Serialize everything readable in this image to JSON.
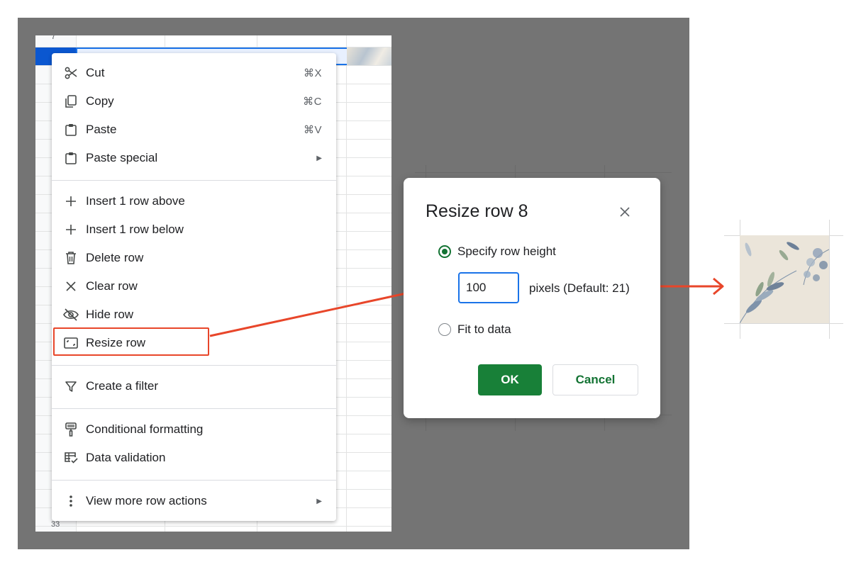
{
  "sheet": {
    "top_row_number": "7",
    "bottom_row_number": "33"
  },
  "context_menu": {
    "items": [
      {
        "label": "Cut",
        "shortcut": "⌘X",
        "icon": "scissors-icon"
      },
      {
        "label": "Copy",
        "shortcut": "⌘C",
        "icon": "copy-icon"
      },
      {
        "label": "Paste",
        "shortcut": "⌘V",
        "icon": "clipboard-icon"
      },
      {
        "label": "Paste special",
        "submenu": "▶",
        "icon": "clipboard-icon"
      },
      {
        "label": "Insert 1 row above",
        "icon": "plus-icon"
      },
      {
        "label": "Insert 1 row below",
        "icon": "plus-icon"
      },
      {
        "label": "Delete row",
        "icon": "trash-icon"
      },
      {
        "label": "Clear row",
        "icon": "close-icon"
      },
      {
        "label": "Hide row",
        "icon": "eye-off-icon"
      },
      {
        "label": "Resize row",
        "icon": "resize-icon"
      },
      {
        "label": "Create a filter",
        "icon": "filter-icon"
      },
      {
        "label": "Conditional formatting",
        "icon": "paint-roller-icon"
      },
      {
        "label": "Data validation",
        "icon": "data-validation-icon"
      },
      {
        "label": "View more row actions",
        "submenu": "▶",
        "icon": "more-vert-icon"
      }
    ],
    "highlighted_item": "Resize row"
  },
  "dialog": {
    "title": "Resize row 8",
    "option_specify": "Specify row height",
    "height_value": "100",
    "pixels_hint": "pixels (Default: 21)",
    "option_fit": "Fit to data",
    "selected_option": "Specify row height",
    "ok_label": "OK",
    "cancel_label": "Cancel"
  },
  "colors": {
    "annotation": "#e8462a",
    "ok_button": "#188038",
    "accent_blue": "#1a73e8",
    "backdrop": "#747474"
  }
}
